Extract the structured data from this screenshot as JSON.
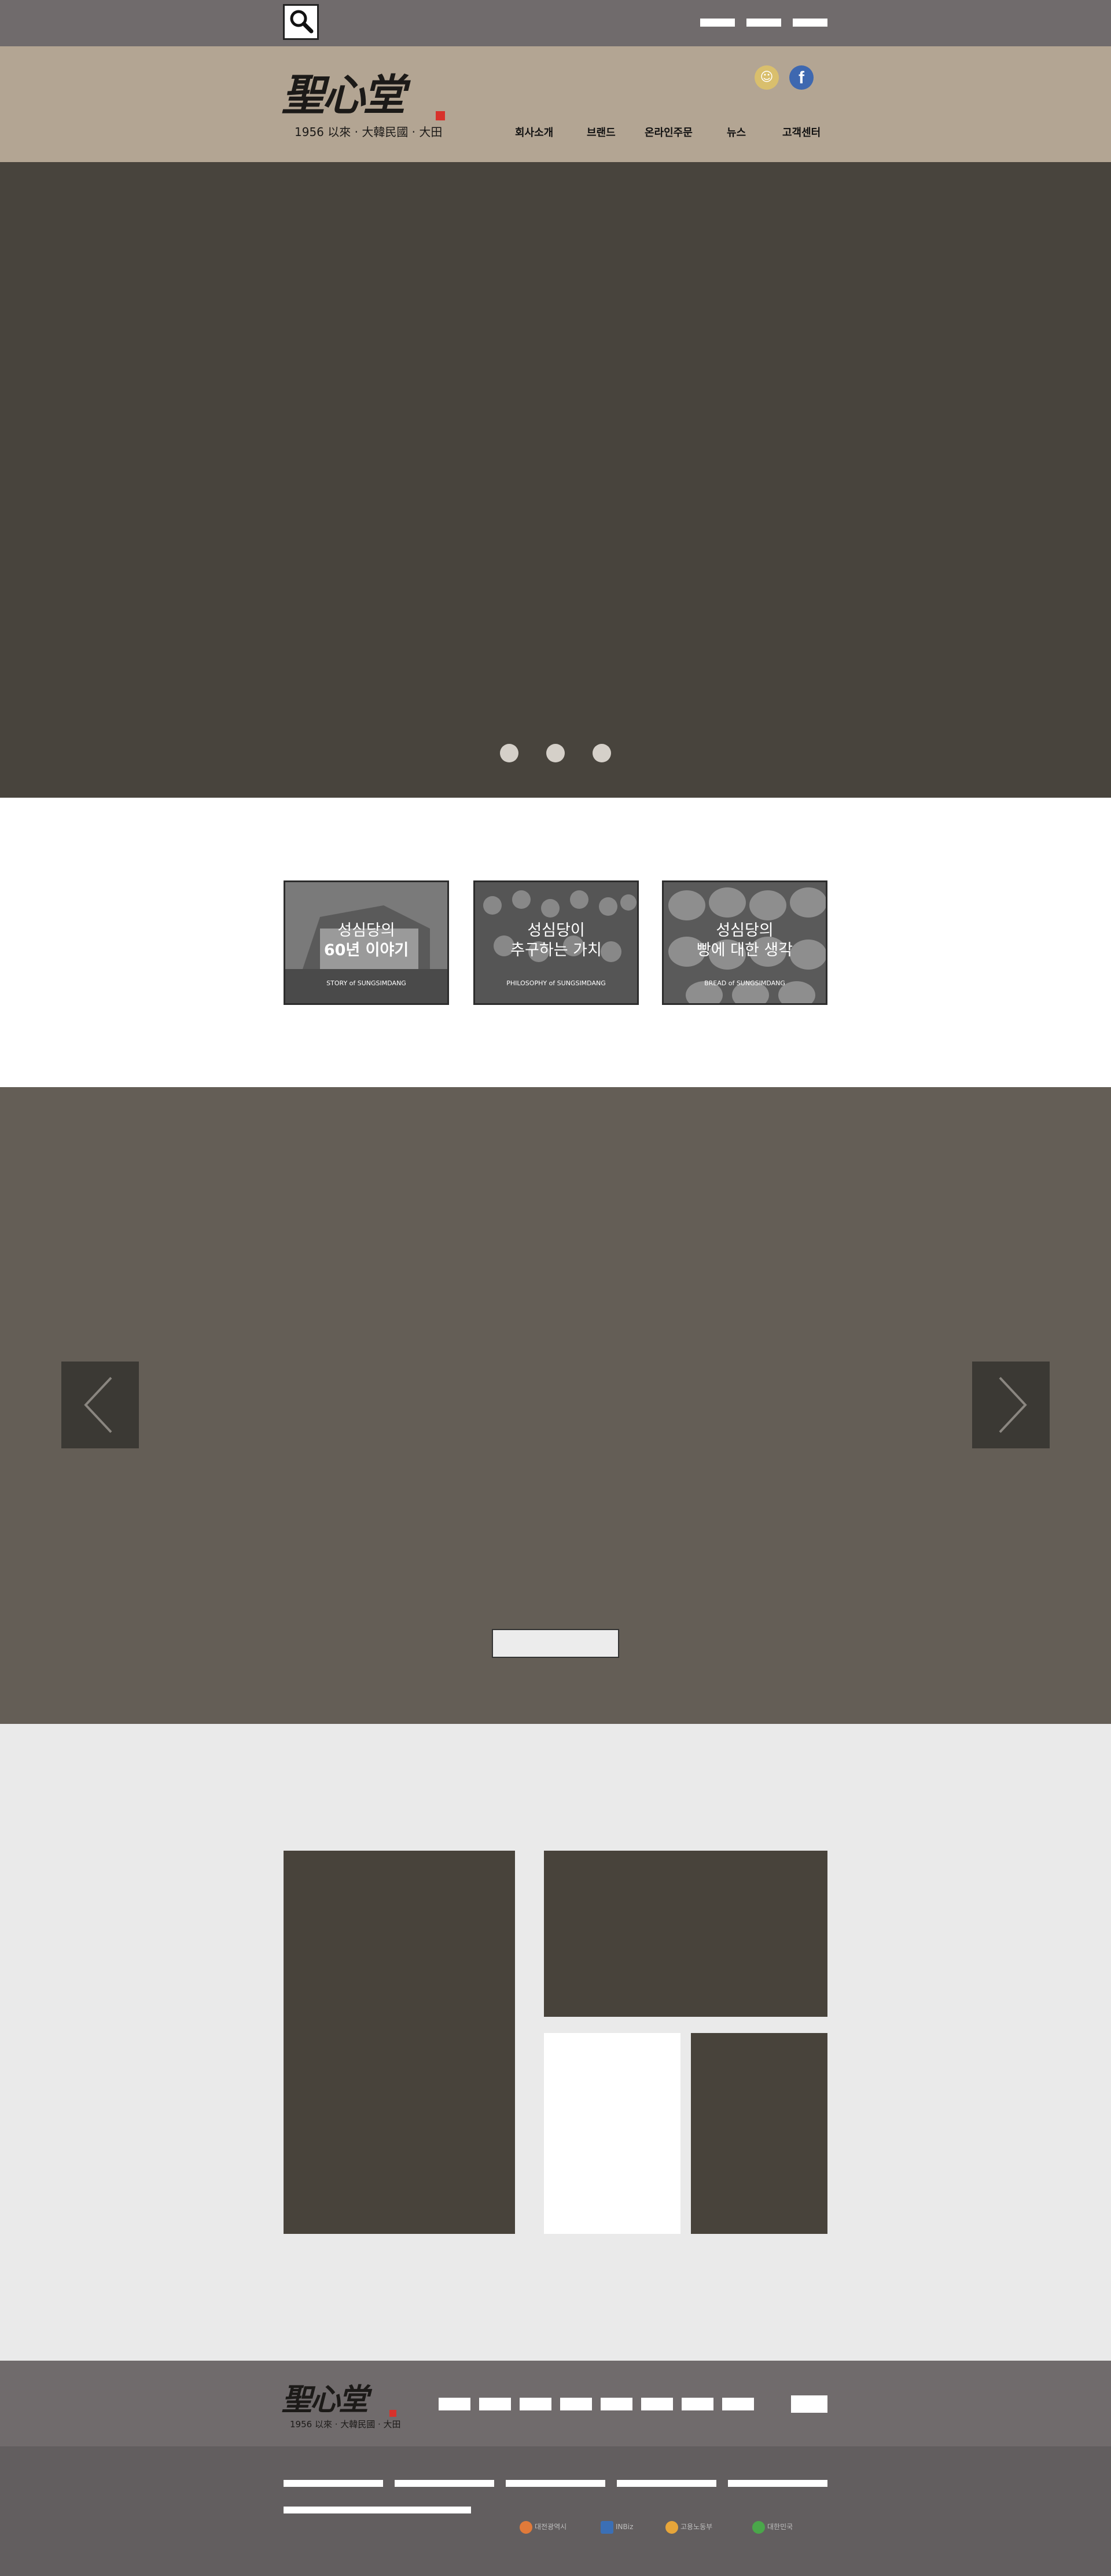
{
  "topbar": {
    "search_icon": "search-icon",
    "links": [
      "",
      "",
      ""
    ]
  },
  "header": {
    "logo": {
      "text": "聖心堂",
      "subtitle": "1956 以來 · 大韓民國 · 大田"
    },
    "social": [
      {
        "name": "sms-icon",
        "glyph": "☺"
      },
      {
        "name": "facebook-icon",
        "glyph": "f"
      }
    ],
    "nav": [
      "회사소개",
      "브랜드",
      "온라인주문",
      "뉴스",
      "고객센터"
    ]
  },
  "hero": {
    "dots": 3
  },
  "story_cards": [
    {
      "line1": "성심당의",
      "line2": "60년 이야기",
      "caption": "STORY of SUNGSIMDANG"
    },
    {
      "line1": "성심당이",
      "line2": "추구하는 가치",
      "caption": "PHILOSOPHY of SUNGSIMDANG"
    },
    {
      "line1": "성심당의",
      "line2": "빵에 대한 생각",
      "caption": "BREAD of SUNGSIMDANG"
    }
  ],
  "slider": {
    "prev_icon": "chevron-left-icon",
    "next_icon": "chevron-right-icon",
    "button_label": ""
  },
  "footer": {
    "logo": {
      "text": "聖心堂",
      "subtitle": "1956 以來 · 大韓民國 · 大田"
    },
    "partners": [
      "대전광역시",
      "INBiz",
      "고용노동부",
      "대한민국"
    ]
  },
  "colors": {
    "topbar": "#706b6c",
    "header": "#b3a593",
    "hero": "#48443d",
    "slider": "#645e56",
    "tiles_bg": "#eaeaea",
    "tile": "#48433b",
    "footer_bottom": "#625e5f"
  }
}
